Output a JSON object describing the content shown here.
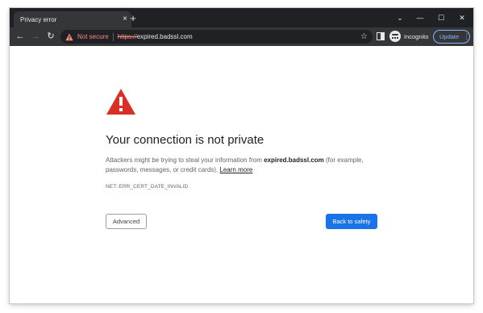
{
  "tab": {
    "title": "Privacy error",
    "close_icon": "×",
    "new_tab_icon": "+"
  },
  "window_controls": {
    "tab_search_icon": "⌄",
    "minimize_icon": "—",
    "maximize_icon": "☐",
    "close_icon": "✕"
  },
  "toolbar": {
    "back_icon": "←",
    "forward_icon": "→",
    "reload_icon": "↻",
    "security_label": "Not secure",
    "url_scheme": "https://",
    "url_host": "expired.badssl.com",
    "bookmark_icon": "☆",
    "profile_label": "Incognito",
    "update_label": "Update",
    "menu_icon": "⋮"
  },
  "colors": {
    "danger": "#f28b82",
    "warning_red": "#d93025",
    "primary_blue": "#1a73e8"
  },
  "interstitial": {
    "heading": "Your connection is not private",
    "description_prefix": "Attackers might be trying to steal your information from ",
    "description_host": "expired.badssl.com",
    "description_suffix": " (for example, passwords, messages, or credit cards). ",
    "learn_more": "Learn more",
    "error_code": "NET::ERR_CERT_DATE_INVALID",
    "advanced_button": "Advanced",
    "back_button": "Back to safety"
  }
}
